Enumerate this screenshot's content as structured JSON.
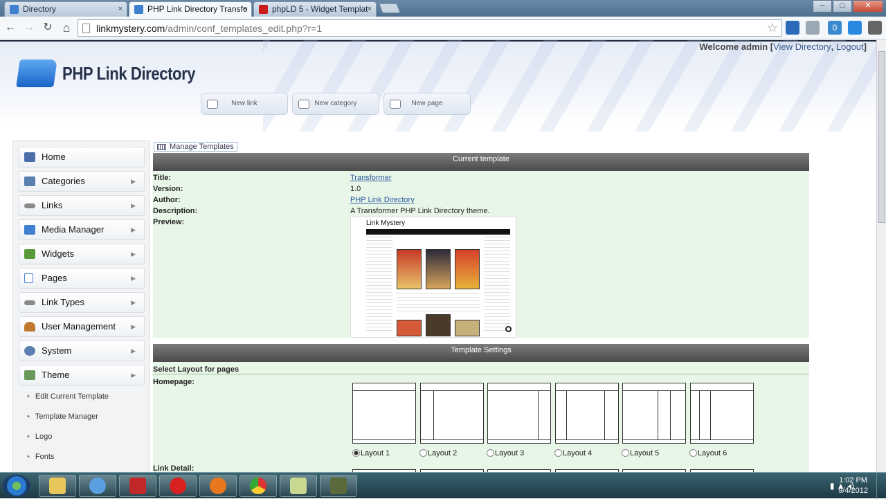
{
  "browser": {
    "tabs": [
      {
        "title": "Directory",
        "close": "×"
      },
      {
        "title": "PHP Link Directory Transfo",
        "close": "×"
      },
      {
        "title": "phpLD 5 - Widget Templat",
        "close": "×"
      }
    ],
    "window_buttons": {
      "minimize": "–",
      "maximize": "□",
      "close": "✕"
    },
    "url_host": "linkmystery.com",
    "url_path": "/admin/conf_templates_edit.php?r=1",
    "nav": {
      "back": "←",
      "forward": "→",
      "reload": "↻",
      "home": "⌂"
    },
    "star": "☆",
    "ext_badge": "0"
  },
  "header": {
    "welcome_text": "Welcome admin [",
    "view_directory": "View Directory",
    "separator": ",",
    "logout": "Logout",
    "close_bracket": "]",
    "logo_text": "PHP Link Directory",
    "quick_buttons": [
      {
        "label": "New link",
        "icon": "link-icon"
      },
      {
        "label": "New category",
        "icon": "category-icon"
      },
      {
        "label": "New page",
        "icon": "page-icon"
      }
    ]
  },
  "sidebar": {
    "items": [
      {
        "label": "Home",
        "icon": "home-icon",
        "color": "#4a6fa8",
        "arrow": ""
      },
      {
        "label": "Categories",
        "icon": "categories-icon",
        "color": "#5a7fb0",
        "arrow": "▶"
      },
      {
        "label": "Links",
        "icon": "links-icon",
        "color": "#8a8a8a",
        "arrow": "▶"
      },
      {
        "label": "Media Manager",
        "icon": "folder-icon",
        "color": "#3f7fd0",
        "arrow": "▶"
      },
      {
        "label": "Widgets",
        "icon": "widgets-icon",
        "color": "#5a9a3a",
        "arrow": "▶"
      },
      {
        "label": "Pages",
        "icon": "pages-icon",
        "color": "#4a7fd0",
        "arrow": "▶"
      },
      {
        "label": "Link Types",
        "icon": "link-types-icon",
        "color": "#8a8a8a",
        "arrow": "▶"
      },
      {
        "label": "User Management",
        "icon": "user-icon",
        "color": "#c07a30",
        "arrow": "▶"
      },
      {
        "label": "System",
        "icon": "gear-icon",
        "color": "#5a7fb0",
        "arrow": "▶"
      },
      {
        "label": "Theme",
        "icon": "theme-icon",
        "color": "#6a9a5a",
        "arrow": "▶"
      }
    ],
    "sub_items": [
      "Edit Current Template",
      "Template Manager",
      "Logo",
      "Fonts"
    ]
  },
  "main": {
    "manage_templates": "Manage Templates",
    "current_template_title": "Current template",
    "fields": [
      {
        "label": "Title:",
        "value": "Transformer",
        "link": true
      },
      {
        "label": "Version:",
        "value": "1.0",
        "link": false
      },
      {
        "label": "Author:",
        "value": "PHP Link Directory",
        "link": true
      },
      {
        "label": "Description:",
        "value": "A Transformer PHP Link Directory theme.",
        "link": false
      },
      {
        "label": "Preview:",
        "value": "",
        "link": false
      }
    ],
    "preview_title": "Link Mystery",
    "template_settings_title": "Template Settings",
    "select_layout_label": "Select Layout for pages",
    "homepage_label": "Homepage:",
    "link_detail_label": "Link Detail:",
    "layouts": [
      "Layout 1",
      "Layout 2",
      "Layout 3",
      "Layout 4",
      "Layout 5",
      "Layout 6"
    ],
    "selected_layout": "Layout 1"
  },
  "taskbar": {
    "time": "1:02 PM",
    "date": "9/4/2012",
    "apps": [
      {
        "name": "explorer-icon",
        "color": "#e7c65a"
      },
      {
        "name": "safari-icon",
        "color": "#5aa0e0"
      },
      {
        "name": "filezilla-icon",
        "color": "#c0282a"
      },
      {
        "name": "opera-icon",
        "color": "#d82020"
      },
      {
        "name": "firefox-icon",
        "color": "#e8781e"
      },
      {
        "name": "chrome-icon",
        "color": "#3c9a40"
      },
      {
        "name": "notes-icon",
        "color": "#c8d890"
      },
      {
        "name": "camtasia-icon",
        "color": "#5a6a3a"
      }
    ],
    "tray_icons": "▮ ▲ ◂)"
  }
}
